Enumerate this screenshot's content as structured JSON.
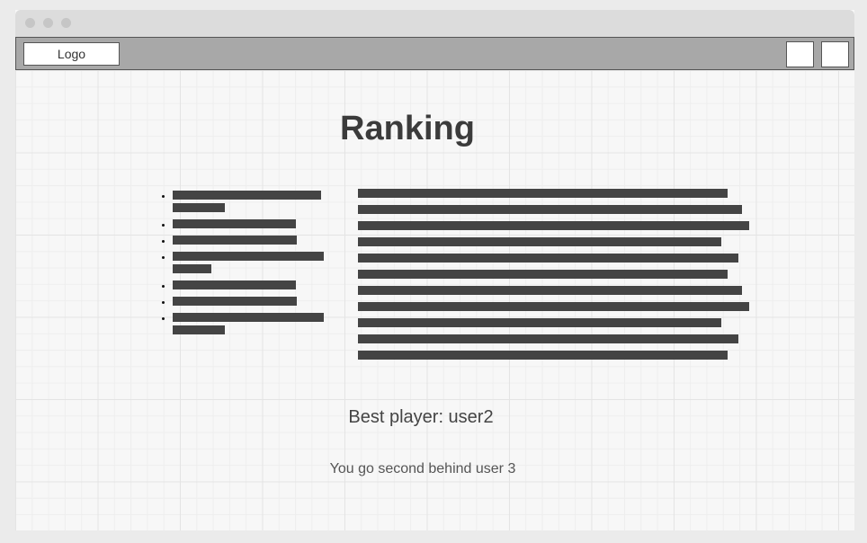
{
  "navbar": {
    "logo_label": "Logo"
  },
  "page": {
    "title": "Ranking",
    "best_player": "Best player: user2",
    "position_text": "You go second behind user 3"
  },
  "colors": {
    "navbar_bg": "#a8a8a8",
    "bar": "#444444",
    "background": "#f7f7f7"
  }
}
